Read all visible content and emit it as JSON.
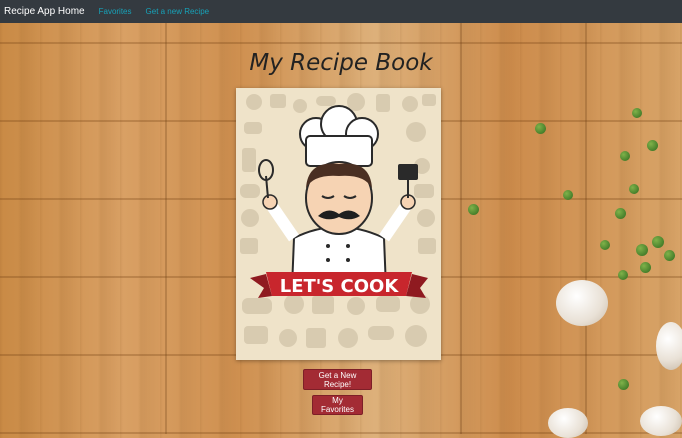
{
  "navbar": {
    "brand": "Recipe App Home",
    "links": [
      "Favorites",
      "Get a new Recipe"
    ]
  },
  "page": {
    "title": "My Recipe Book"
  },
  "cover": {
    "banner_text": "LET'S COOK"
  },
  "buttons": {
    "new_recipe": "Get a New Recipe!",
    "favorites": "My Favorites"
  },
  "colors": {
    "navbar_bg": "#343a40",
    "nav_link": "#17a2b8",
    "button_bg": "#a32b34",
    "banner_red": "#c8262d"
  }
}
